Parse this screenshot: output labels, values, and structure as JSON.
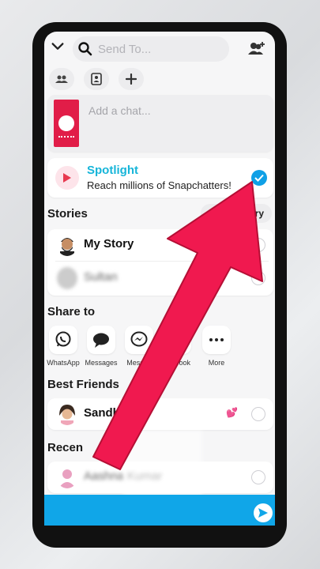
{
  "topbar": {
    "search_placeholder": "Send To...",
    "icons": [
      "chevron-down-icon",
      "search-icon",
      "add-friend-icon"
    ]
  },
  "pills": [
    "groups-icon",
    "contact-card-icon",
    "plus-icon"
  ],
  "chat": {
    "placeholder": "Add a chat..."
  },
  "spotlight": {
    "title": "Spotlight",
    "subtitle": "Reach millions of Snapchatters!",
    "selected": true
  },
  "stories": {
    "header": "Stories",
    "new_story": "ory",
    "items": [
      {
        "label": "My Story"
      },
      {
        "label": "Sultan"
      }
    ]
  },
  "share": {
    "header": "Share to",
    "items": [
      {
        "label": "WhatsApp",
        "icon": "whatsapp-icon"
      },
      {
        "label": "Messages",
        "icon": "messages-icon"
      },
      {
        "label": "Messen",
        "icon": "messenger-icon"
      },
      {
        "label": "acebook",
        "icon": "facebook-icon"
      },
      {
        "label": "More",
        "icon": "more-icon"
      }
    ]
  },
  "best_friends": {
    "header": "Best Friends",
    "items": [
      {
        "label": "Sandhy",
        "emoji": "💕"
      }
    ]
  },
  "recents": {
    "header": "Recen",
    "items": [
      {
        "label": "Aashna Kumar"
      }
    ]
  },
  "colors": {
    "accent": "#10a6e8",
    "spotlight": "#16b5d9",
    "arrow": "#f0194f"
  }
}
